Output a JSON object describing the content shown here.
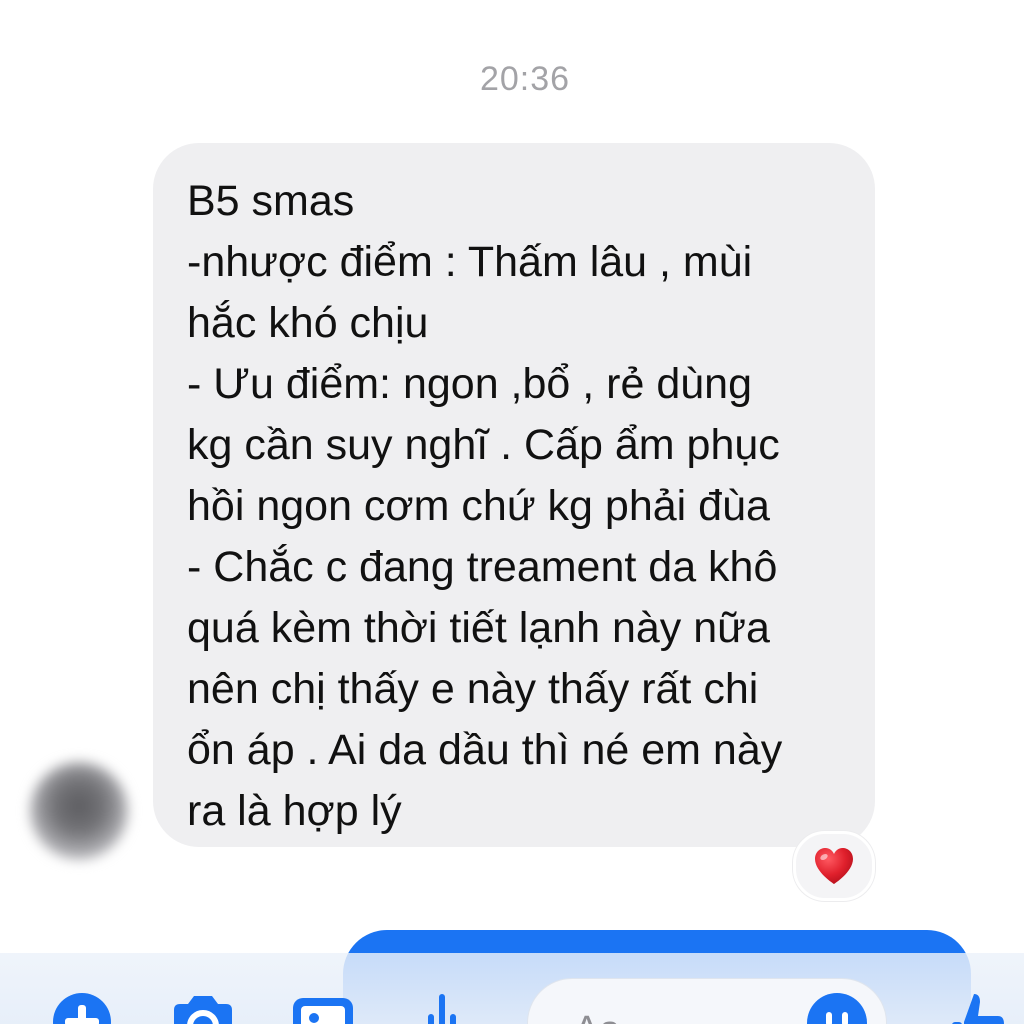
{
  "conversation": {
    "timestamp": "20:36",
    "incoming_message": {
      "lines": [
        "B5 smas",
        "-nhược điểm : Thấm lâu , mùi",
        "hắc khó chịu",
        "- Ưu điểm: ngon ,bổ , rẻ dùng",
        "kg cần suy nghĩ . Cấp ẩm phục",
        "hồi ngon cơm chứ kg phải đùa",
        "- Chắc c đang treament da khô",
        "quá kèm thời tiết lạnh này nữa",
        "nên chị thấy e này thấy rất chi",
        "ổn áp . Ai da dầu thì né em này",
        "ra là hợp lý"
      ],
      "reaction_icon": "heart-icon"
    }
  },
  "composer": {
    "placeholder": "Aa",
    "icons": [
      "plus-icon",
      "camera-icon",
      "gallery-icon",
      "microphone-icon",
      "emoji-icon",
      "thumbs-up-icon"
    ]
  },
  "colors": {
    "accent": "#1b74f3",
    "incoming_bubble": "#efeff1",
    "timestamp_text": "#a3a3a7",
    "heart": "#e0202c"
  }
}
